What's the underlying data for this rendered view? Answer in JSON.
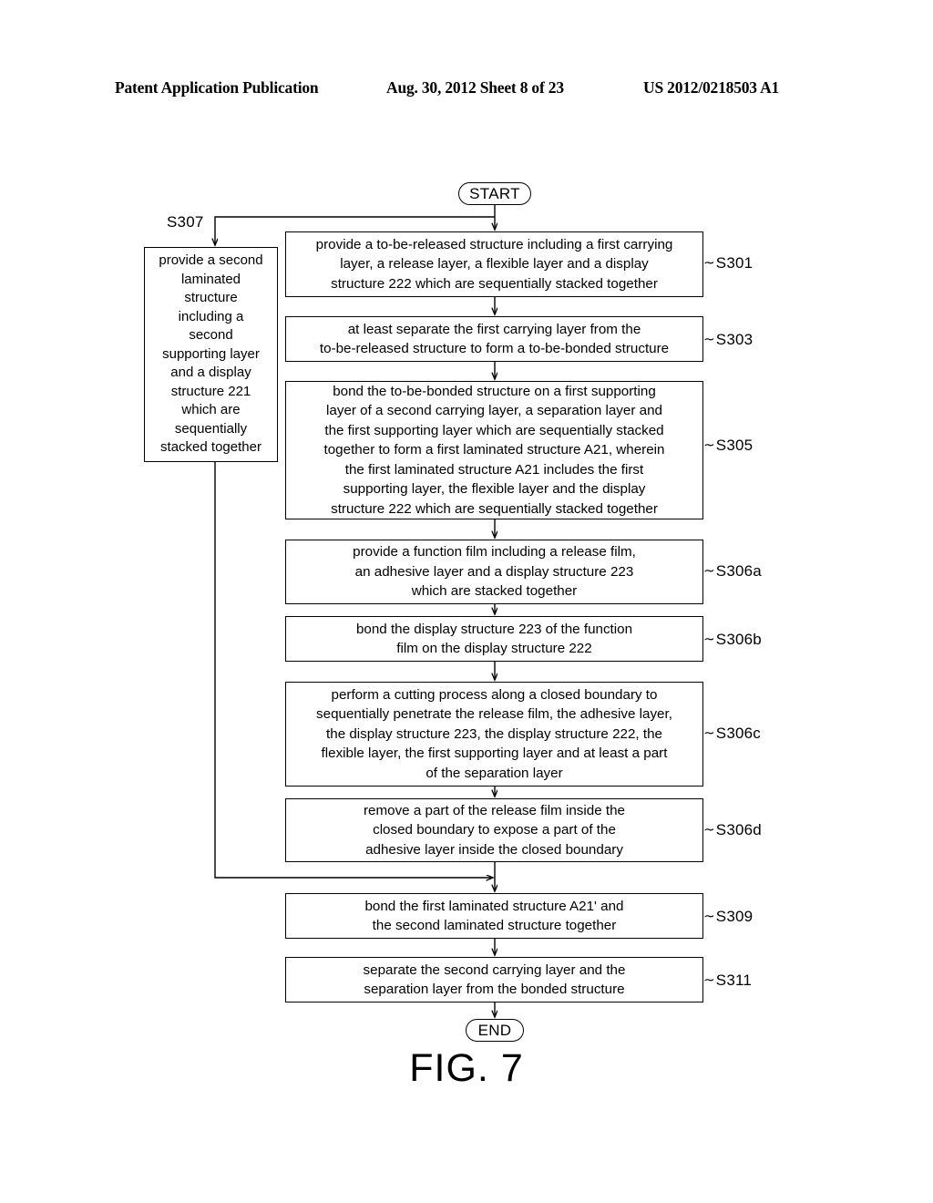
{
  "header": {
    "publication": "Patent Application Publication",
    "date_sheet": "Aug. 30, 2012  Sheet 8 of 23",
    "patent_number": "US 2012/0218503 A1"
  },
  "figure": {
    "caption": "FIG. 7",
    "start_label": "START",
    "end_label": "END"
  },
  "flow": {
    "s307": {
      "id": "S307",
      "text": "provide a second\nlaminated\nstructure\nincluding a\nsecond\nsupporting layer\nand a display\nstructure 221\nwhich are\nsequentially\nstacked together"
    },
    "s301": {
      "id": "S301",
      "text": "provide a to-be-released structure including a first carrying\nlayer, a release layer, a flexible layer and a display\nstructure 222 which are sequentially stacked together"
    },
    "s303": {
      "id": "S303",
      "text": "at least separate the first carrying layer from the\nto-be-released structure to form a to-be-bonded structure"
    },
    "s305": {
      "id": "S305",
      "text": "bond the to-be-bonded structure on a first supporting\nlayer of a second carrying layer, a separation layer and\nthe first supporting layer which are sequentially stacked\ntogether to form a first laminated structure A21, wherein\nthe first laminated structure A21 includes the first\nsupporting layer, the flexible layer and the display\nstructure 222 which are sequentially stacked together"
    },
    "s306a": {
      "id": "S306a",
      "text": "provide a function film including a release film,\nan adhesive layer and a display structure 223\nwhich are stacked together"
    },
    "s306b": {
      "id": "S306b",
      "text": "bond the display structure 223 of the function\nfilm on the display structure 222"
    },
    "s306c": {
      "id": "S306c",
      "text": "perform a cutting process along a closed boundary to\nsequentially penetrate the release film, the adhesive layer,\nthe display structure 223, the display structure 222, the\nflexible layer, the first supporting layer and at least a part\nof the separation layer"
    },
    "s306d": {
      "id": "S306d",
      "text": "remove a part of the release film inside the\nclosed boundary to expose a part of the\nadhesive layer inside the closed boundary"
    },
    "s309": {
      "id": "S309",
      "text": "bond the first laminated structure A21' and\nthe second laminated structure together"
    },
    "s311": {
      "id": "S311",
      "text": "separate the second carrying layer and the\nseparation layer from the bonded structure"
    }
  },
  "label_tick": "∼",
  "colors": {
    "ink": "#000000",
    "paper": "#ffffff"
  }
}
